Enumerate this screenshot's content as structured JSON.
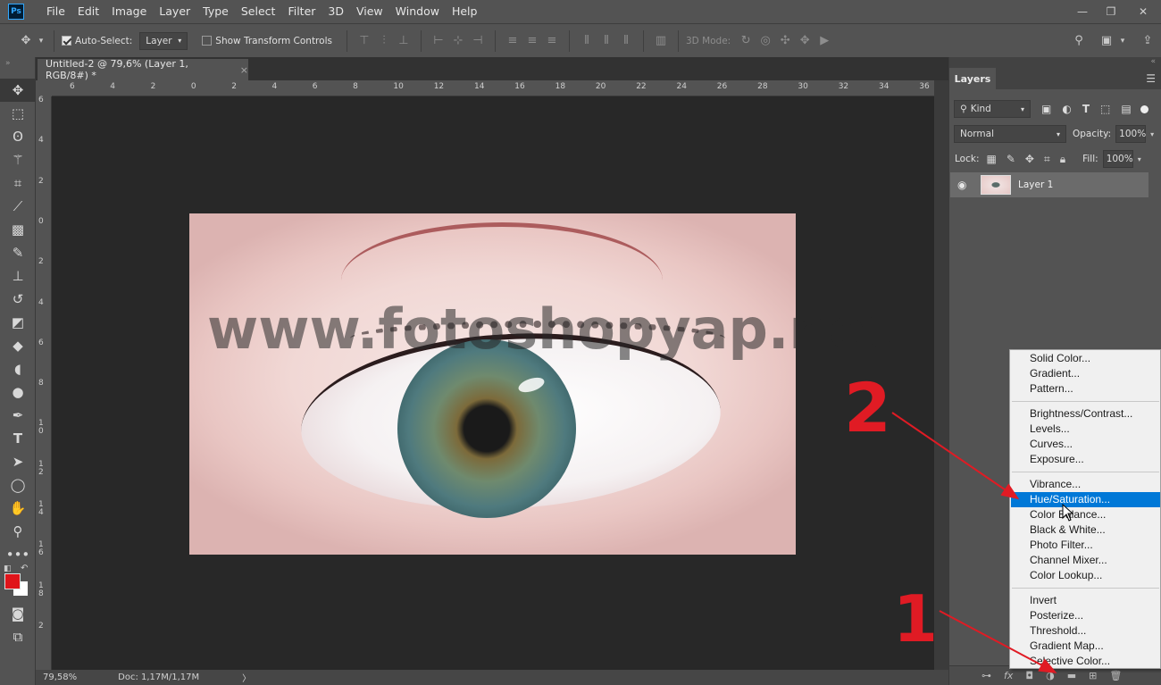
{
  "app": {
    "logo": "Ps"
  },
  "menubar": [
    "File",
    "Edit",
    "Image",
    "Layer",
    "Type",
    "Select",
    "Filter",
    "3D",
    "View",
    "Window",
    "Help"
  ],
  "options": {
    "auto_select_label": "Auto-Select:",
    "auto_select_value": "Layer",
    "show_transform_label": "Show Transform Controls",
    "mode_3d_label": "3D Mode:"
  },
  "document": {
    "tab_title": "Untitled-2 @ 79,6% (Layer 1, RGB/8#) *",
    "close": "×",
    "watermark": "www.fotoshopyap.net"
  },
  "ruler_h": [
    "6",
    "4",
    "2",
    "0",
    "2",
    "4",
    "6",
    "8",
    "10",
    "12",
    "14",
    "16",
    "18",
    "20",
    "22",
    "24",
    "26",
    "28",
    "30",
    "32",
    "34",
    "36"
  ],
  "ruler_v": [
    "6",
    "4",
    "2",
    "0",
    "2",
    "4",
    "6",
    "8",
    "1 0",
    "1 2",
    "1 4",
    "1 6",
    "1 8",
    "2"
  ],
  "status": {
    "zoom": "79,58%",
    "doc": "Doc: 1,17M/1,17M"
  },
  "layers_panel": {
    "tab": "Layers",
    "kind_label": "Kind",
    "blend_mode": "Normal",
    "opacity_label": "Opacity:",
    "opacity_value": "100%",
    "lock_label": "Lock:",
    "fill_label": "Fill:",
    "fill_value": "100%",
    "layer_name": "Layer 1"
  },
  "adjustment_menu": {
    "group1": [
      "Solid Color...",
      "Gradient...",
      "Pattern..."
    ],
    "group2": [
      "Brightness/Contrast...",
      "Levels...",
      "Curves...",
      "Exposure..."
    ],
    "group3": [
      "Vibrance...",
      "Hue/Saturation...",
      "Color Balance...",
      "Black & White...",
      "Photo Filter...",
      "Channel Mixer...",
      "Color Lookup..."
    ],
    "group4": [
      "Invert",
      "Posterize...",
      "Threshold...",
      "Gradient Map...",
      "Selective Color..."
    ],
    "selected": "Hue/Saturation..."
  },
  "annotations": {
    "step1": "1",
    "step2": "2"
  },
  "colors": {
    "foreground": "#e0141a",
    "background": "#ffffff",
    "highlight": "#0078d7",
    "annotation": "#e01b24"
  }
}
